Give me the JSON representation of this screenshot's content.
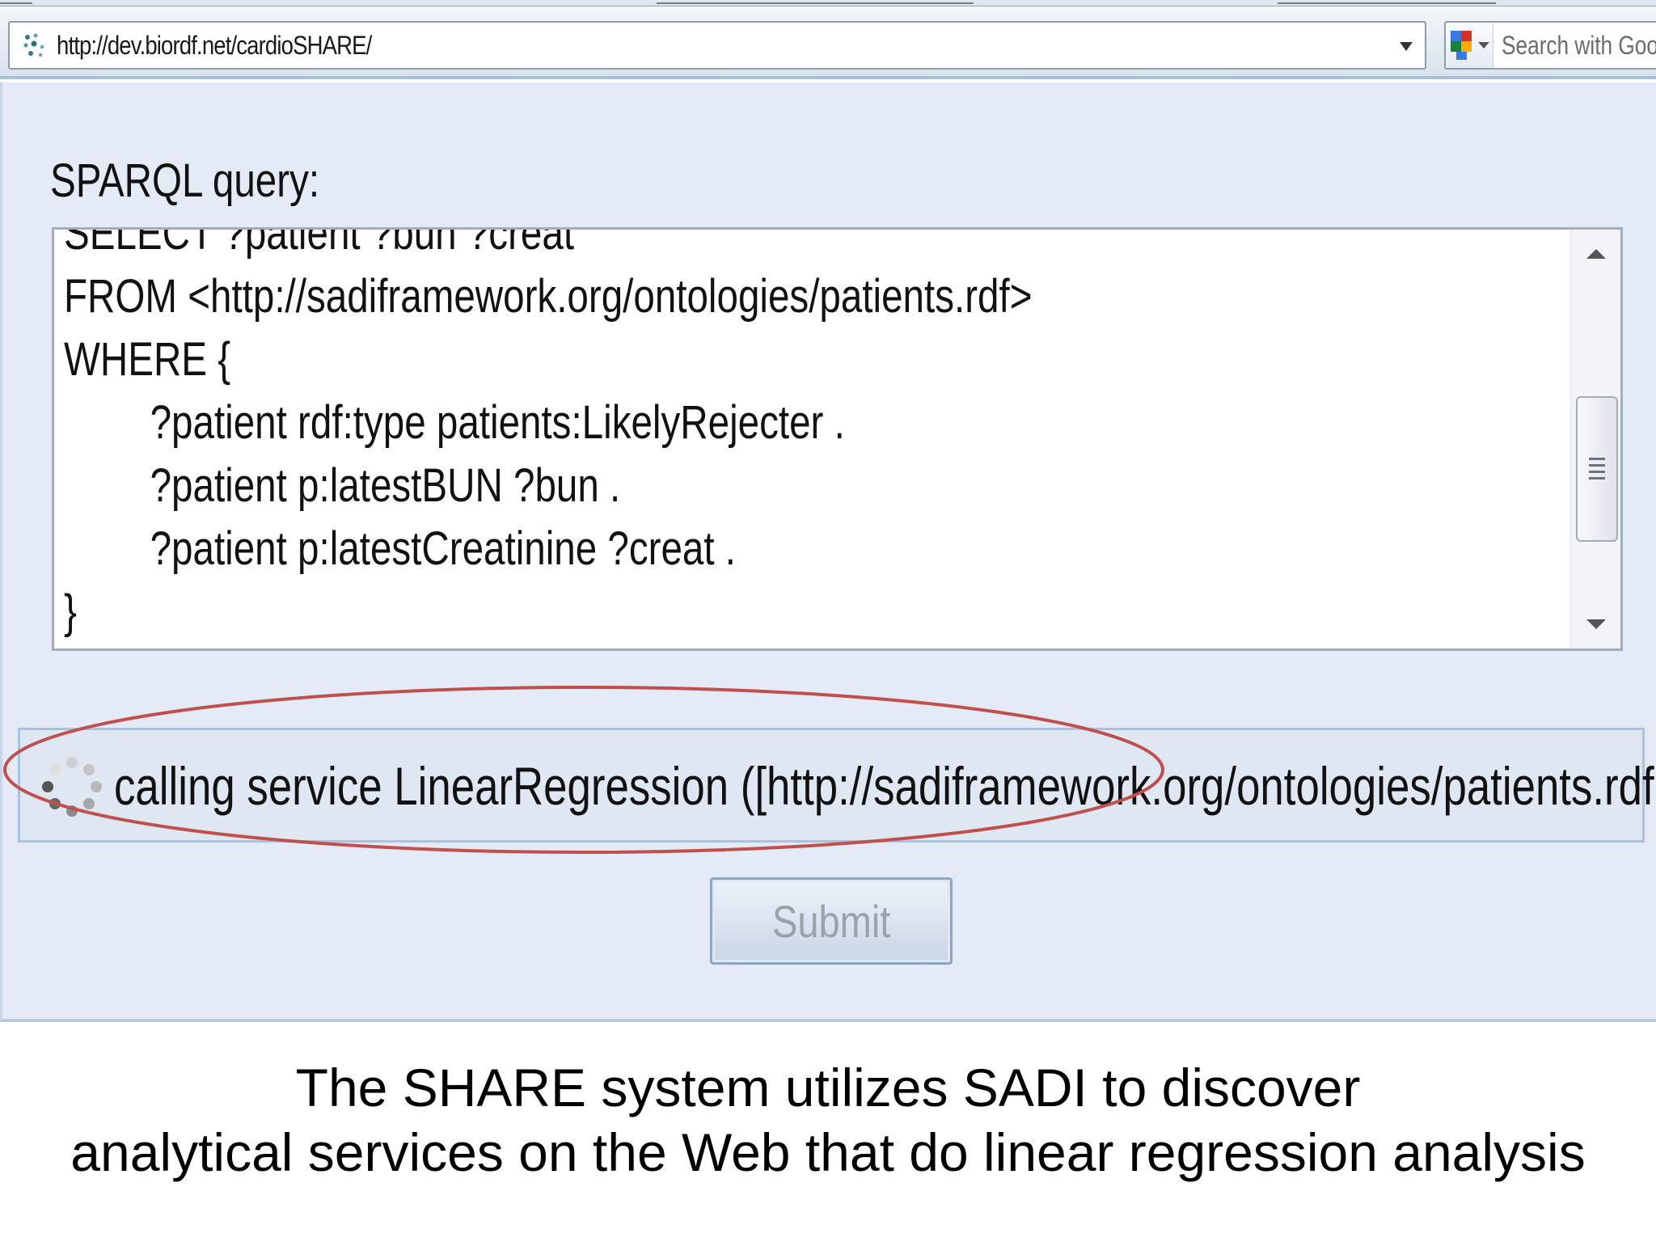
{
  "browser": {
    "address": "http://dev.biordf.net/cardioSHARE/",
    "search_placeholder": "Search with Goo"
  },
  "form": {
    "sparql_label": "SPARQL query:",
    "query_lines": [
      "SELECT ?patient ?bun ?creat",
      "FROM <http://sadiframework.org/ontologies/patients.rdf>",
      "WHERE {",
      "?patient rdf:type patients:LikelyRejecter .",
      "?patient p:latestBUN ?bun .",
      "?patient p:latestCreatinine ?creat .",
      "}"
    ],
    "status_text": "calling service LinearRegression ([http://sadiframework.org/ontologies/patients.rdf",
    "submit_label": "Submit"
  },
  "caption": {
    "line1": "The SHARE system utilizes SADI to discover",
    "line2": "analytical services on the Web that do linear regression analysis"
  },
  "colors": {
    "page_background": "#e4ebf6",
    "highlight_ellipse": "#c0504d",
    "submit_disabled_text": "#9aa2ac"
  }
}
